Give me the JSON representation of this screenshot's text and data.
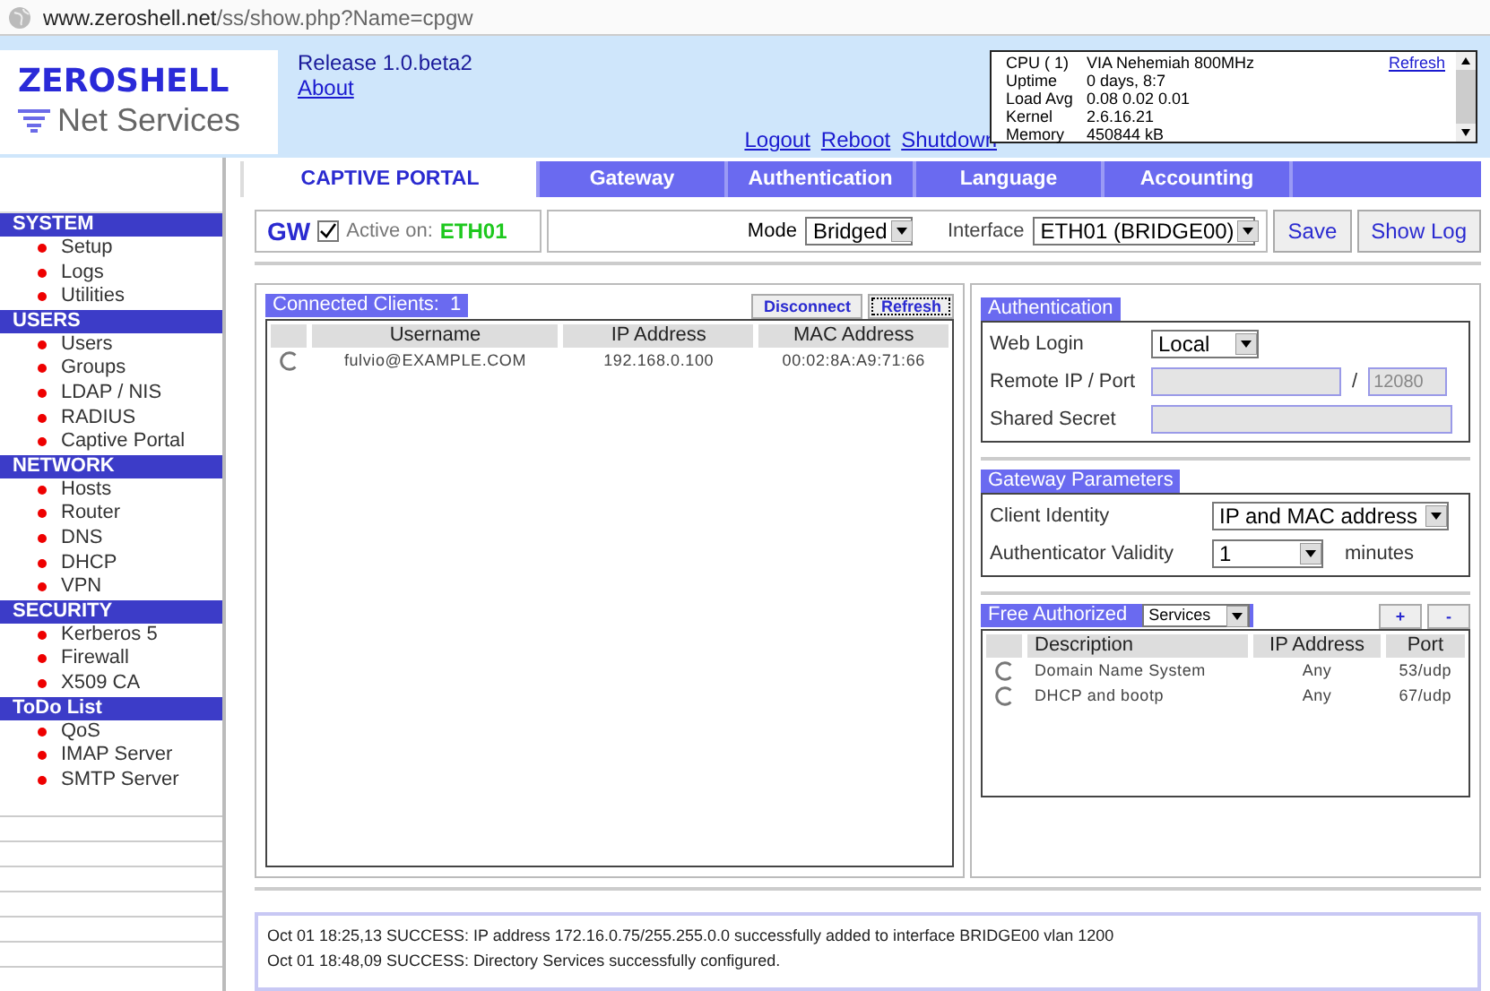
{
  "address_bar": {
    "host": "www.zeroshell.net",
    "path": "/ss/show.php?Name=cpgw"
  },
  "header": {
    "logo_title": "ZEROSHELL",
    "logo_subtitle": "Net Services",
    "release": "Release 1.0.beta2",
    "about": "About",
    "links": [
      "Logout",
      "Reboot",
      "Shutdown"
    ],
    "system_info": {
      "refresh": "Refresh",
      "rows": [
        {
          "label": "CPU ( 1)",
          "value": "VIA Nehemiah 800MHz"
        },
        {
          "label": "Uptime",
          "value": "0 days, 8:7"
        },
        {
          "label": "Load Avg",
          "value": "0.08 0.02 0.01"
        },
        {
          "label": "Kernel",
          "value": "2.6.16.21"
        },
        {
          "label": "Memory",
          "value": "450844 kB"
        }
      ]
    }
  },
  "sidebar": {
    "sections": [
      {
        "title": "SYSTEM",
        "items": [
          "Setup",
          "Logs",
          "Utilities"
        ]
      },
      {
        "title": "USERS",
        "items": [
          "Users",
          "Groups",
          "LDAP / NIS",
          "RADIUS",
          "Captive Portal"
        ]
      },
      {
        "title": "NETWORK",
        "items": [
          "Hosts",
          "Router",
          "DNS",
          "DHCP",
          "VPN"
        ]
      },
      {
        "title": "SECURITY",
        "items": [
          "Kerberos 5",
          "Firewall",
          "X509 CA"
        ]
      },
      {
        "title": "ToDo List",
        "items": [
          "QoS",
          "IMAP Server",
          "SMTP Server"
        ]
      }
    ]
  },
  "tabs": [
    {
      "label": "CAPTIVE PORTAL",
      "selected": true
    },
    {
      "label": "Gateway",
      "selected": false
    },
    {
      "label": "Authentication",
      "selected": false
    },
    {
      "label": "Language",
      "selected": false
    },
    {
      "label": "Accounting",
      "selected": false
    }
  ],
  "toolbar": {
    "title": "GW",
    "active_checked": true,
    "active_label": "Active on:",
    "active_interface": "ETH01",
    "mode_label": "Mode",
    "mode_value": "Bridged",
    "interface_label": "Interface",
    "interface_value": "ETH01 (BRIDGE00)",
    "buttons": [
      "Save",
      "Show Log"
    ]
  },
  "clients": {
    "title": "Connected Clients:",
    "count": "1",
    "buttons": [
      {
        "label": "Disconnect",
        "focused": false
      },
      {
        "label": "Refresh",
        "focused": true
      }
    ],
    "columns": [
      "Username",
      "IP Address",
      "MAC Address"
    ],
    "rows": [
      {
        "selected": false,
        "cells": [
          "fulvio@EXAMPLE.COM",
          "192.168.0.100",
          "00:02:8A:A9:71:66"
        ]
      }
    ]
  },
  "authentication": {
    "title": "Authentication",
    "web_login_label": "Web Login",
    "web_login_value": "Local",
    "remote_label": "Remote IP / Port",
    "remote_ip": {
      "disabled": true
    },
    "separator": "/",
    "remote_port": {
      "placeholder": "12080",
      "disabled": true
    },
    "secret_label": "Shared Secret",
    "shared_secret": {
      "disabled": true
    }
  },
  "gateway_parameters": {
    "title": "Gateway Parameters",
    "identity_label": "Client Identity",
    "identity_value": "IP and MAC address",
    "validity_label": "Authenticator Validity",
    "validity_value": "1",
    "validity_unit": "minutes"
  },
  "free_authorized": {
    "title": "Free Authorized",
    "filter_value": "Services",
    "buttons": [
      "+",
      "-"
    ],
    "columns": [
      "Description",
      "IP Address",
      "Port"
    ],
    "rows": [
      {
        "selected": false,
        "cells": [
          "Domain Name System",
          "Any",
          "53/udp"
        ]
      },
      {
        "selected": false,
        "cells": [
          "DHCP and bootp",
          "Any",
          "67/udp"
        ]
      }
    ]
  },
  "log": [
    "Oct 01 18:25,13 SUCCESS: IP address 172.16.0.75/255.255.0.0 successfully added to interface BRIDGE00 vlan 1200",
    "Oct 01 18:48,09 SUCCESS: Directory Services successfully configured."
  ]
}
